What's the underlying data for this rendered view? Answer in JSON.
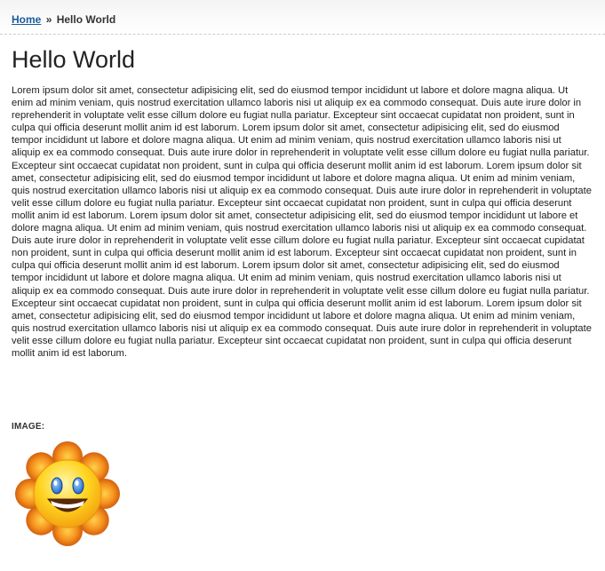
{
  "breadcrumb": {
    "home_label": "Home",
    "separator": "»",
    "current_label": "Hello World"
  },
  "page": {
    "title": "Hello World",
    "body_text": "Lorem ipsum dolor sit amet, consectetur adipisicing elit, sed do eiusmod tempor incididunt ut labore et dolore magna aliqua. Ut enim ad minim veniam, quis nostrud exercitation ullamco laboris nisi ut aliquip ex ea commodo consequat. Duis aute irure dolor in reprehenderit in voluptate velit esse cillum dolore eu fugiat nulla pariatur. Excepteur sint occaecat cupidatat non proident, sunt in culpa qui officia deserunt mollit anim id est laborum. Lorem ipsum dolor sit amet, consectetur adipisicing elit, sed do eiusmod tempor incididunt ut labore et dolore magna aliqua. Ut enim ad minim veniam, quis nostrud exercitation ullamco laboris nisi ut aliquip ex ea commodo consequat. Duis aute irure dolor in reprehenderit in voluptate velit esse cillum dolore eu fugiat nulla pariatur. Excepteur sint occaecat cupidatat non proident, sunt in culpa qui officia deserunt mollit anim id est laborum. Lorem ipsum dolor sit amet, consectetur adipisicing elit, sed do eiusmod tempor incididunt ut labore et dolore magna aliqua. Ut enim ad minim veniam, quis nostrud exercitation ullamco laboris nisi ut aliquip ex ea commodo consequat. Duis aute irure dolor in reprehenderit in voluptate velit esse cillum dolore eu fugiat nulla pariatur. Excepteur sint occaecat cupidatat non proident, sunt in culpa qui officia deserunt mollit anim id est laborum. Lorem ipsum dolor sit amet, consectetur adipisicing elit, sed do eiusmod tempor incididunt ut labore et dolore magna aliqua. Ut enim ad minim veniam, quis nostrud exercitation ullamco laboris nisi ut aliquip ex ea commodo consequat. Duis aute irure dolor in reprehenderit in voluptate velit esse cillum dolore eu fugiat nulla pariatur. Excepteur sint occaecat cupidatat non proident, sunt in culpa qui officia deserunt mollit anim id est laborum. Excepteur sint occaecat cupidatat non proident, sunt in culpa qui officia deserunt mollit anim id est laborum. Lorem ipsum dolor sit amet, consectetur adipisicing elit, sed do eiusmod tempor incididunt ut labore et dolore magna aliqua. Ut enim ad minim veniam, quis nostrud exercitation ullamco laboris nisi ut aliquip ex ea commodo consequat. Duis aute irure dolor in reprehenderit in voluptate velit esse cillum dolore eu fugiat nulla pariatur. Excepteur sint occaecat cupidatat non proident, sunt in culpa qui officia deserunt mollit anim id est laborum. Lorem ipsum dolor sit amet, consectetur adipisicing elit, sed do eiusmod tempor incididunt ut labore et dolore magna aliqua. Ut enim ad minim veniam, quis nostrud exercitation ullamco laboris nisi ut aliquip ex ea commodo consequat. Duis aute irure dolor in reprehenderit in voluptate velit esse cillum dolore eu fugiat nulla pariatur. Excepteur sint occaecat cupidatat non proident, sunt in culpa qui officia deserunt mollit anim id est laborum.",
    "image_label": "IMAGE:",
    "image_icon": "smiling-sun-icon"
  },
  "colors": {
    "link": "#1a5a9c",
    "text": "#222222",
    "sun_petal": "#f08a1c",
    "sun_face": "#ffd21f"
  }
}
